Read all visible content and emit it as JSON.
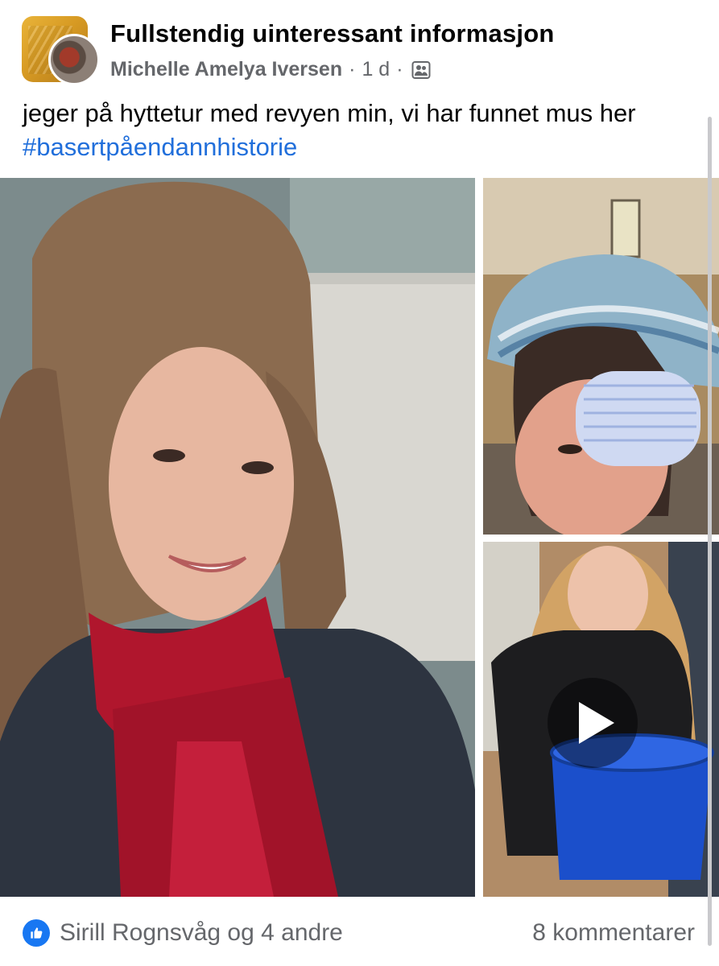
{
  "group": {
    "name": "Fullstendig uinteressant informasjon"
  },
  "post": {
    "author": "Michelle Amelya Iversen",
    "time": "1 d",
    "audience_icon": "group-members-icon",
    "text": "jeger på hyttetur med revyen min, vi har funnet mus her ",
    "hashtag": "#basertpåendannhistorie"
  },
  "media": [
    {
      "type": "photo",
      "description": "selfie-red-scarf"
    },
    {
      "type": "photo",
      "description": "knit-hat-hair-roller"
    },
    {
      "type": "video",
      "description": "blue-bucket"
    }
  ],
  "footer": {
    "reactions": "Sirill Rognsvåg og 4 andre",
    "comments": "8 kommentarer",
    "like_color": "#1877f2"
  }
}
